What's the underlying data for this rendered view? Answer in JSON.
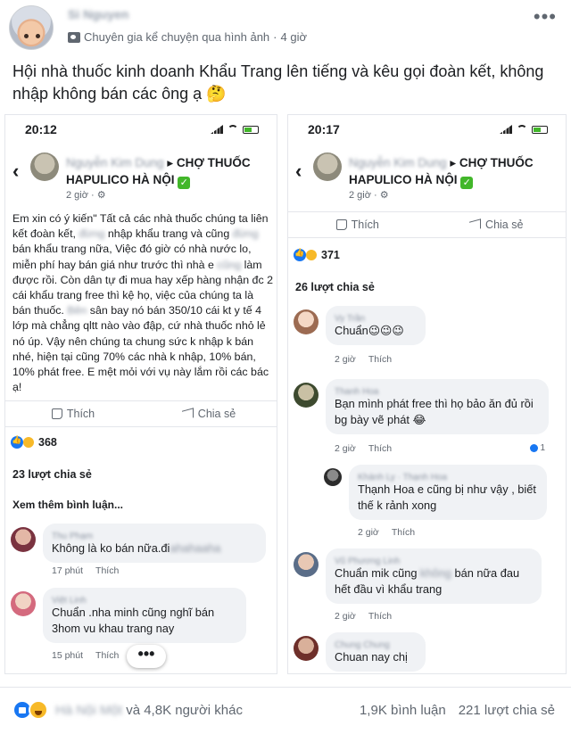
{
  "post": {
    "author_name": "Si Nguyen",
    "category": "Chuyên gia kể chuyện qua hình ảnh",
    "time": "4 giờ",
    "text": "Hội nhà thuốc kinh doanh Khẩu Trang lên tiếng và kêu gọi đoàn kết, không nhập không bán các ông ạ 🤔",
    "more_icon": "more-horizontal-icon"
  },
  "left_shot": {
    "time": "20:12",
    "group_author": "Nguyễn Kim Dung",
    "group_title": "CHỢ THUỐC HAPULICO HÀ NỘI",
    "group_meta": "2 giờ · ⚙",
    "body_parts": [
      "Em xin có ý kiến\" Tất cả các nhà thuốc chúng ta liên kết đoàn kết, ",
      "đừng",
      " nhập khẩu trang và cũng ",
      "đừng",
      " bán khẩu trang nữa, Việc đó giờ có nhà nước lo, miễn phí hay bán giá như trước thì nhà e ",
      "cũng",
      " làm được rồi. Còn dân tự đi mua hay xếp hàng nhận đc 2 cái khẩu trang free thì kệ họ, việc của chúng ta là bán thuốc. ",
      "Bên",
      " sân bay nó bán 350/10 cái kt y tế 4 lớp mà chẳng qltt nào vào đập, cứ nhà thuốc nhỏ lẻ nó úp. Vậy nên chúng ta chung sức k nhập k bán nhé, hiện tại cũng 70% các nhà k nhập, 10% bán, 10% phát free. E mệt mỏi với vụ này lắm rồi các bác ạ!"
    ],
    "like_label": "Thích",
    "share_label": "Chia sẻ",
    "reactions": "368",
    "shares": "23 lượt chia sẻ",
    "more_comments": "Xem thêm bình luận...",
    "comments": [
      {
        "name": "Thu Phạm",
        "text": "Không là ko bán nữa.đi",
        "text_blur": "ahahaaha",
        "time": "17 phút",
        "like": "Thích"
      },
      {
        "name": "Việt Linh",
        "text": "Chuẩn .nha minh cũng nghĩ bán 3hom vu khau trang nay",
        "time": "15 phút",
        "like": "Thích"
      }
    ]
  },
  "right_shot": {
    "time": "20:17",
    "group_author": "Nguyễn Kim Dung",
    "group_title": "CHỢ THUỐC HAPULICO HÀ NỘI",
    "group_meta": "2 giờ · ⚙",
    "like_label": "Thích",
    "share_label": "Chia sẻ",
    "reactions": "371",
    "shares": "26 lượt chia sẻ",
    "comments": [
      {
        "name": "Vy Trần",
        "text": "Chuẩn😉😉😉",
        "time": "2 giờ",
        "like": "Thích"
      },
      {
        "name": "Thanh Hoa",
        "text": "Bạn mình phát free thì họ bảo ăn đủ rồi bg bày vẽ phát 😂",
        "time": "2 giờ",
        "like": "Thích",
        "replies": "1"
      },
      {
        "name": "Khánh Ly · Thạnh Hoa",
        "text": "Thạnh Hoa e cũng bị như vậy , biết thế k rảnh xong",
        "time": "2 giờ",
        "like": "Thích"
      },
      {
        "name": "Vũ Phương Linh",
        "text": "Chuẩn mik cũng ",
        "text_blur": "không",
        "text_after": " bán nữa đau hết đầu vì khẩu trang",
        "time": "2 giờ",
        "like": "Thích"
      },
      {
        "name": "Chung Chung",
        "text": "Chuan nay chị",
        "time": "",
        "like": ""
      }
    ]
  },
  "footer": {
    "names": "Hà Nội Một",
    "others": "và 4,8K người khác",
    "comments": "1,9K bình luận",
    "shares": "221 lượt chia sẻ"
  },
  "colors": {
    "accent": "#1877f2",
    "haha": "#f7b928",
    "verified": "#42b72a",
    "bubble": "#f0f2f5",
    "muted": "#606770"
  }
}
